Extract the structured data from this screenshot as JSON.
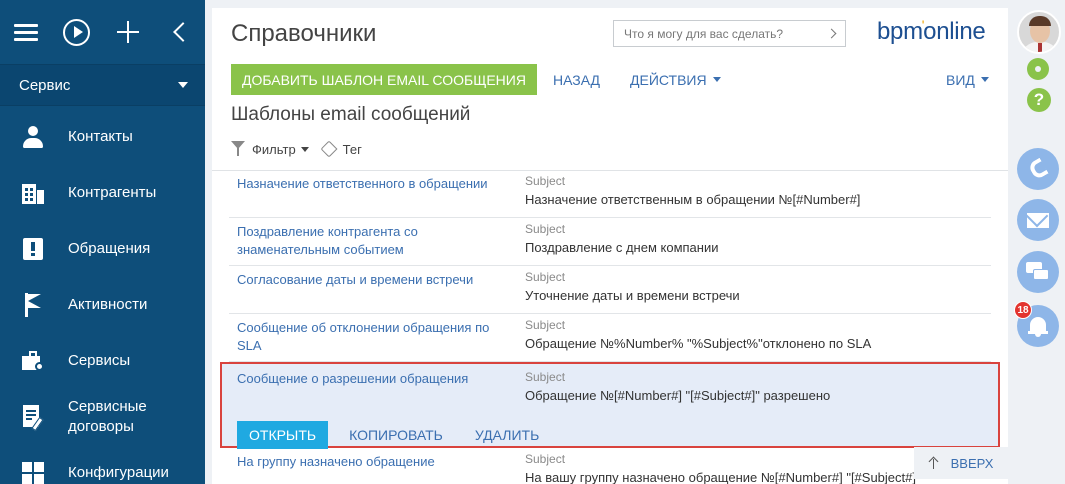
{
  "sidebar": {
    "workspace": "Сервис",
    "items": [
      {
        "label": "Контакты",
        "icon": "person-icon"
      },
      {
        "label": "Контрагенты",
        "icon": "building-icon"
      },
      {
        "label": "Обращения",
        "icon": "exclamation-icon"
      },
      {
        "label": "Активности",
        "icon": "flag-icon"
      },
      {
        "label": "Сервисы",
        "icon": "briefcase-icon"
      },
      {
        "label": "Сервисные договоры",
        "icon": "contract-icon"
      },
      {
        "label": "Конфигурации",
        "icon": "grid-icon"
      }
    ]
  },
  "header": {
    "title": "Справочники",
    "search_placeholder": "Что я могу для вас сделать?",
    "logo_left": "bpm",
    "logo_dot": "'",
    "logo_right": "online"
  },
  "toolbar": {
    "add_label": "ДОБАВИТЬ ШАБЛОН EMAIL СООБЩЕНИЯ",
    "back_label": "НАЗАД",
    "actions_label": "ДЕЙСТВИЯ",
    "view_label": "ВИД"
  },
  "section_title": "Шаблоны email сообщений",
  "filters": {
    "filter_label": "Фильтр",
    "tag_label": "Тег"
  },
  "column_label": "Subject",
  "rows": [
    {
      "name": "Назначение ответственного в обращении",
      "subject": "Назначение ответственным в обращении №[#Number#]"
    },
    {
      "name": "Поздравление контрагента со знаменательным событием",
      "subject": "Поздравление с днем компании"
    },
    {
      "name": "Согласование даты и времени встречи",
      "subject": "Уточнение даты и времени встречи"
    },
    {
      "name": "Сообщение об отклонении обращения по SLA",
      "subject": "Обращение №%Number% \"%Subject%\"отклонено по SLA"
    },
    {
      "name": "Сообщение о разрешении обращения",
      "subject": "Обращение №[#Number#] \"[#Subject#]\" разрешено"
    },
    {
      "name": "На группу назначено обращение",
      "subject": "На вашу группу назначено обращение №[#Number#] \"[#Subject#]\""
    }
  ],
  "row_actions": {
    "open": "ОТКРЫТЬ",
    "copy": "КОПИРОВАТЬ",
    "delete": "УДАЛИТЬ"
  },
  "back_to_top": "ВВЕРХ",
  "notifications": {
    "count": "18"
  },
  "colors": {
    "sidebar": "#0e4e7a",
    "accent_green": "#8ac34a",
    "open_button": "#1fa9e1",
    "link": "#3b6fb0",
    "selection_border": "#d9433e",
    "badge": "#e3342f"
  }
}
